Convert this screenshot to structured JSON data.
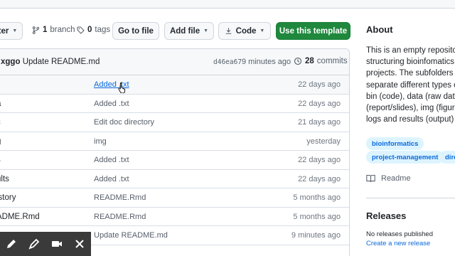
{
  "toolbar": {
    "branch_select_label": "ter",
    "branch_count": "1",
    "branch_word": "branch",
    "tag_count": "0",
    "tag_word": "tags",
    "goto_file": "Go to file",
    "add_file": "Add file",
    "code": "Code",
    "use_template": "Use this template"
  },
  "latest_commit": {
    "author": "xggo",
    "message": "Update README.md",
    "sha": "d46ea67",
    "time": "9 minutes ago",
    "commit_count": "28",
    "commit_word": "commits"
  },
  "files": [
    {
      "name": "",
      "message": "Added .txt",
      "age": "22 days ago",
      "link": true
    },
    {
      "name": "a",
      "message": "Added .txt",
      "age": "22 days ago",
      "link": false
    },
    {
      "name": "c",
      "message": "Edit doc directory",
      "age": "21 days ago",
      "link": false
    },
    {
      "name": "g",
      "message": "img",
      "age": "yesterday",
      "link": false
    },
    {
      "name": "s",
      "message": "Added .txt",
      "age": "22 days ago",
      "link": false
    },
    {
      "name": "ults",
      "message": "Added .txt",
      "age": "22 days ago",
      "link": false
    },
    {
      "name": "istory",
      "message": "README.Rmd",
      "age": "5 months ago",
      "link": false
    },
    {
      "name": "ADME.Rmd",
      "message": "README.Rmd",
      "age": "5 months ago",
      "link": false
    },
    {
      "name": "",
      "message": "Update README.md",
      "age": "9 minutes ago",
      "link": false
    }
  ],
  "sidebar": {
    "about_heading": "About",
    "about_lines": [
      "This is an empty reposito",
      "structuring bioinfomatics",
      "projects. The subfolders",
      "separate different types o",
      "bin (code), data (raw dat",
      "(report/slides), img (figur",
      "logs and results (output)"
    ],
    "topics": [
      "bioinformatics",
      "project-management",
      "dire"
    ],
    "readme_label": "Readme",
    "releases_heading": "Releases",
    "no_releases": "No releases published",
    "create_release": "Create a new release"
  },
  "colors": {
    "accent_green": "#1f883d",
    "link_blue": "#0969da",
    "topic_bg": "#ddf4ff",
    "annot_bar": "#3a3a3a"
  },
  "icons": [
    "branch-icon",
    "tag-icon",
    "history-icon",
    "book-icon",
    "pen-icon",
    "highlighter-icon",
    "camera-icon",
    "close-icon"
  ]
}
